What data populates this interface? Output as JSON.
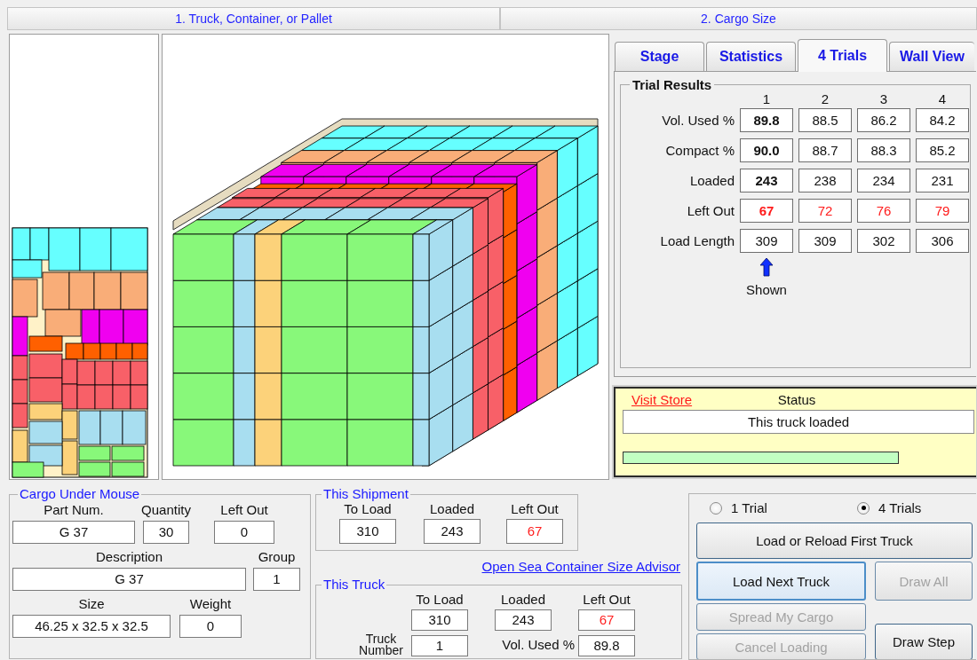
{
  "steps": [
    {
      "label": "1. Truck, Container, or Pallet"
    },
    {
      "label": "2. Cargo Size"
    }
  ],
  "result_tabs": [
    {
      "label": "Stage",
      "selected": false
    },
    {
      "label": "Statistics",
      "selected": false
    },
    {
      "label": "4 Trials",
      "selected": true
    },
    {
      "label": "Wall View",
      "selected": false
    }
  ],
  "trial_results": {
    "title": "Trial Results",
    "columns": [
      {
        "label": "1",
        "selected": true
      },
      {
        "label": "2",
        "selected": false
      },
      {
        "label": "3",
        "selected": false
      },
      {
        "label": "4",
        "selected": false
      }
    ],
    "rows": [
      {
        "label": "Vol. Used %",
        "kind": "figure",
        "values": [
          "89.8",
          "88.5",
          "86.2",
          "84.2"
        ]
      },
      {
        "label": "Compact %",
        "kind": "figure",
        "values": [
          "90.0",
          "88.7",
          "88.3",
          "85.2"
        ]
      },
      {
        "label": "Loaded",
        "kind": "figure",
        "values": [
          "243",
          "238",
          "234",
          "231"
        ]
      },
      {
        "label": "Left Out",
        "kind": "shortfall",
        "values": [
          "67",
          "72",
          "76",
          "79"
        ]
      },
      {
        "label": "Load Length",
        "kind": "plain",
        "values": [
          "309",
          "309",
          "302",
          "306"
        ]
      }
    ],
    "shown_label": "Shown"
  },
  "status": {
    "link": "Visit Store",
    "title": "Status",
    "message": "This truck loaded"
  },
  "cargo_under_mouse": {
    "title": "Cargo Under Mouse",
    "fields": [
      {
        "label": "Part Num.",
        "value": "G 37"
      },
      {
        "label": "Quantity",
        "value": "30"
      },
      {
        "label": "Left Out",
        "value": "0"
      },
      {
        "label": "Description",
        "value": "G 37"
      },
      {
        "label": "Group",
        "value": "1"
      },
      {
        "label": "Size",
        "value": "46.25 x 32.5 x 32.5"
      },
      {
        "label": "Weight",
        "value": "0"
      }
    ]
  },
  "this_shipment": {
    "title": "This Shipment",
    "fields": [
      {
        "label": "To Load",
        "value": "310",
        "kind": "count"
      },
      {
        "label": "Loaded",
        "value": "243",
        "kind": "count"
      },
      {
        "label": "Left Out",
        "value": "67",
        "kind": "shortfall"
      }
    ]
  },
  "advisor_link": "Open Sea Container Size Advisor",
  "this_truck": {
    "title": "This Truck",
    "fields": [
      {
        "label": "To Load",
        "value": "310",
        "kind": "count"
      },
      {
        "label": "Loaded",
        "value": "243",
        "kind": "count"
      },
      {
        "label": "Left Out",
        "value": "67",
        "kind": "shortfall"
      },
      {
        "label": "Truck Number",
        "value": "1",
        "kind": "count"
      },
      {
        "label": "Vol. Used %",
        "value": "89.8",
        "kind": "count"
      }
    ]
  },
  "trial_modes": [
    {
      "label": "1 Trial",
      "selected": false
    },
    {
      "label": "4 Trials",
      "selected": true
    }
  ],
  "buttons": [
    {
      "label": "Load or Reload First Truck",
      "disabled": false,
      "focused": false
    },
    {
      "label": "Load Next Truck",
      "disabled": false,
      "focused": true
    },
    {
      "label": "Draw All",
      "disabled": true,
      "focused": false
    },
    {
      "label": "Spread My Cargo",
      "disabled": true,
      "focused": false
    },
    {
      "label": "Cancel Loading",
      "disabled": true,
      "focused": false
    },
    {
      "label": "Draw Step",
      "disabled": false,
      "focused": false
    }
  ]
}
